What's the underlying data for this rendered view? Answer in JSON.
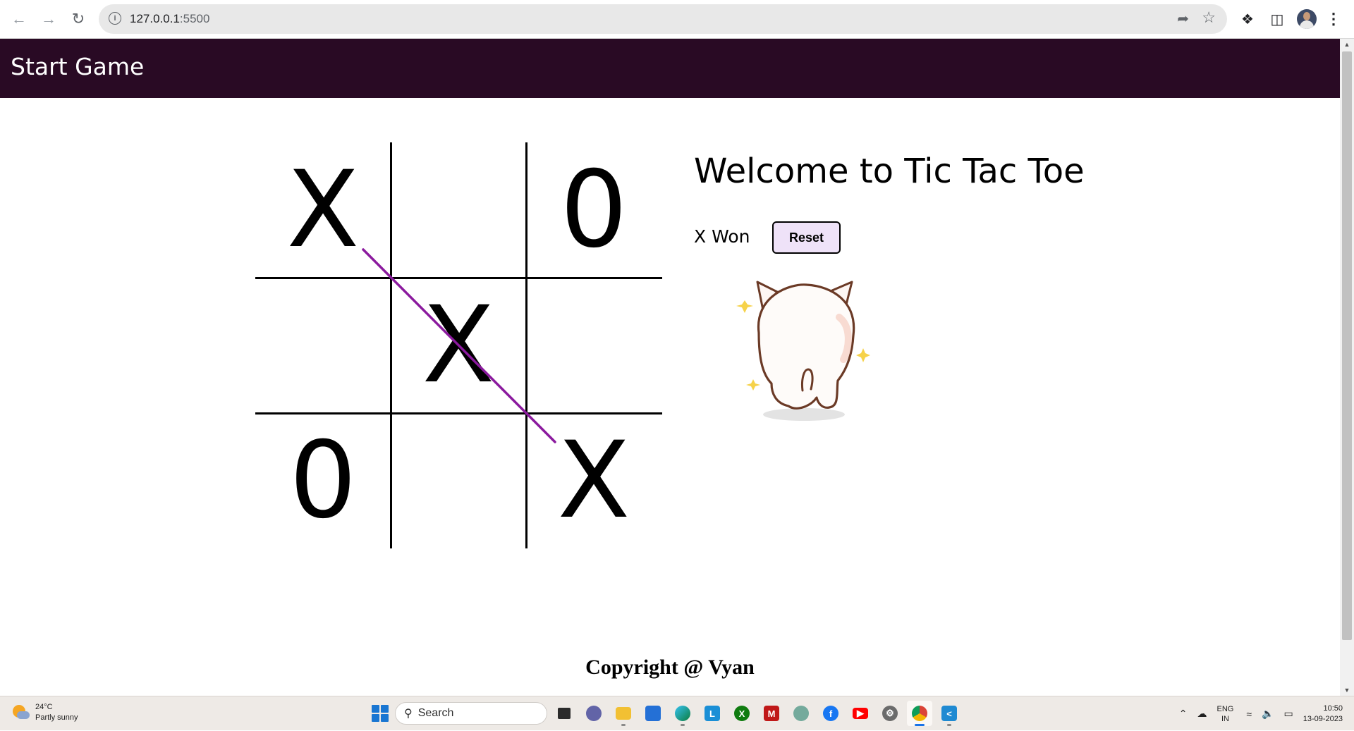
{
  "browser": {
    "url_host": "127.0.0.1",
    "url_port": ":5500"
  },
  "navbar": {
    "title": "Start Game"
  },
  "board": {
    "cells": [
      "X",
      "",
      "0",
      "",
      "X",
      "",
      "0",
      "",
      "X"
    ],
    "winning_cells": [
      0,
      4,
      8
    ],
    "win_line_color": "#8b1a9e"
  },
  "info": {
    "welcome": "Welcome to Tic Tac Toe",
    "status": "X Won",
    "reset_label": "Reset"
  },
  "footer": {
    "text": "Copyright @ Vyan"
  },
  "taskbar": {
    "weather_temp": "24°C",
    "weather_desc": "Partly sunny",
    "search_label": "Search",
    "lang_top": "ENG",
    "lang_bottom": "IN",
    "time": "10:50",
    "date": "13-09-2023"
  },
  "colors": {
    "navbar_bg": "#290a24",
    "reset_bg": "#efe2f8"
  }
}
